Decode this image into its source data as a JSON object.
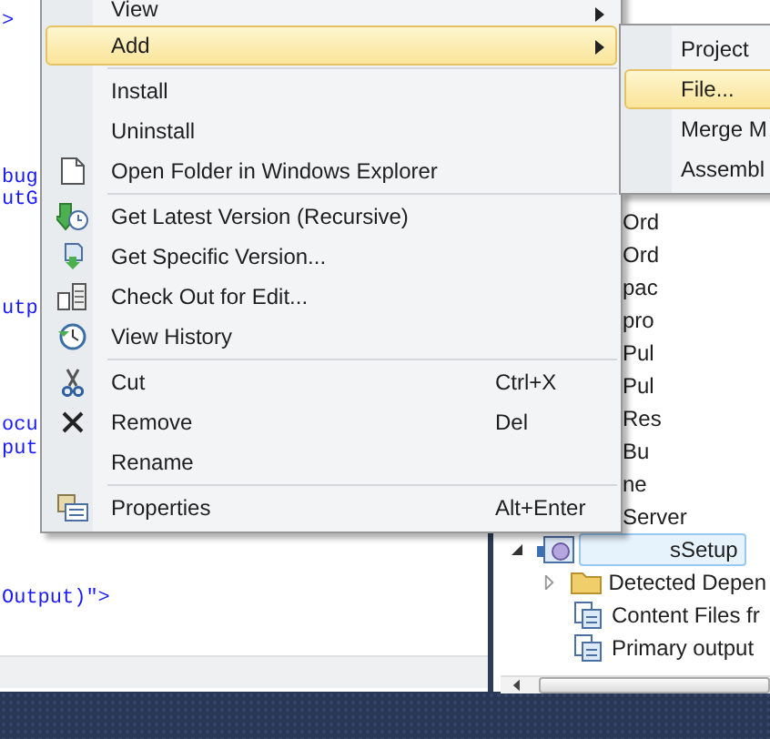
{
  "editor": {
    "code_lines": [
      ">",
      "bug",
      "utG",
      "utp",
      "ocu",
      "put",
      "Output)\">"
    ]
  },
  "solution_explorer": {
    "files": [
      "Ord",
      "Ord",
      "pac",
      "pro",
      "Pul",
      "Pul",
      "Res",
      "Bu",
      "ne",
      "Server"
    ],
    "project": {
      "label": "sSetup",
      "selected": true,
      "expanded": true,
      "children": [
        {
          "label": "Detected Depen",
          "expanded": false
        },
        {
          "label": "Content Files fr"
        },
        {
          "label": "Primary output"
        }
      ]
    }
  },
  "context_menu": {
    "items": [
      {
        "kind": "item",
        "label": "View",
        "submenu": true,
        "selected": false
      },
      {
        "kind": "item",
        "label": "Add",
        "submenu": true,
        "selected": true
      },
      {
        "kind": "separator"
      },
      {
        "kind": "item",
        "label": "Install",
        "selected": false
      },
      {
        "kind": "item",
        "label": "Uninstall",
        "selected": false
      },
      {
        "kind": "item",
        "label": "Open Folder in Windows Explorer",
        "selected": false
      },
      {
        "kind": "separator"
      },
      {
        "kind": "item",
        "label": "Get Latest Version (Recursive)",
        "selected": false
      },
      {
        "kind": "item",
        "label": "Get Specific Version...",
        "selected": false
      },
      {
        "kind": "item",
        "label": "Check Out for Edit...",
        "selected": false
      },
      {
        "kind": "item",
        "label": "View History",
        "selected": false
      },
      {
        "kind": "separator"
      },
      {
        "kind": "item",
        "label": "Cut",
        "shortcut": "Ctrl+X",
        "selected": false
      },
      {
        "kind": "item",
        "label": "Remove",
        "shortcut": "Del",
        "selected": false
      },
      {
        "kind": "item",
        "label": "Rename",
        "selected": false
      },
      {
        "kind": "separator"
      },
      {
        "kind": "item",
        "label": "Properties",
        "shortcut": "Alt+Enter",
        "selected": false
      }
    ]
  },
  "submenu": {
    "items": [
      {
        "label": "Project",
        "selected": false
      },
      {
        "label": "File...",
        "selected": true
      },
      {
        "label": "Merge M",
        "selected": false
      },
      {
        "label": "Assembl",
        "selected": false
      }
    ]
  }
}
